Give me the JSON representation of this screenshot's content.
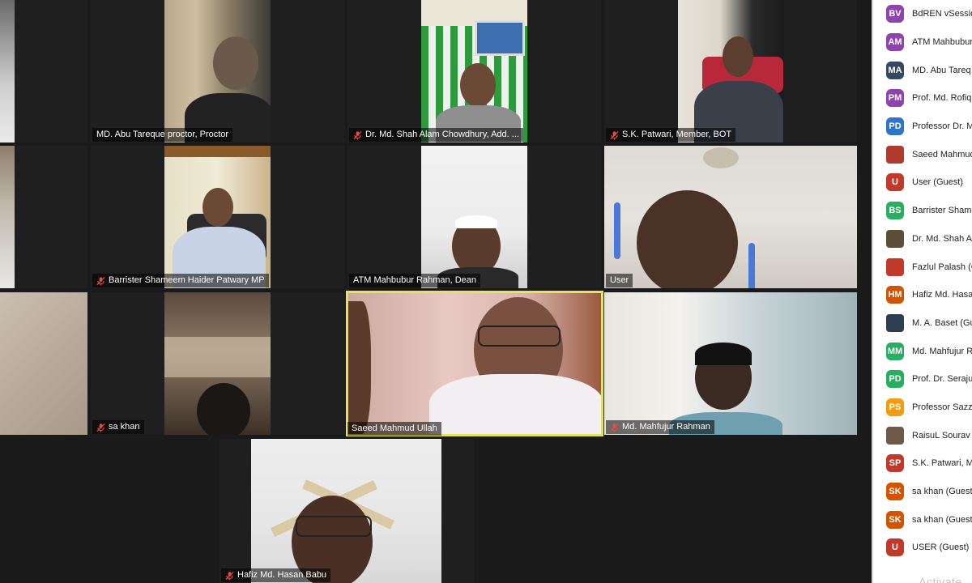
{
  "tiles": [
    {
      "id": "t1",
      "name": "",
      "muted": false
    },
    {
      "id": "t2",
      "name": "MD. Abu Tareque proctor, Proctor",
      "muted": false
    },
    {
      "id": "t3",
      "name": "Dr. Md. Shah Alam Chowdhury, Add. ...",
      "muted": true
    },
    {
      "id": "t4",
      "name": "S.K. Patwari, Member, BOT",
      "muted": true
    },
    {
      "id": "t5",
      "name": "",
      "muted": false
    },
    {
      "id": "t6",
      "name": "Barrister Shameem Haider Patwary MP",
      "muted": true
    },
    {
      "id": "t7",
      "name": "ATM Mahbubur Rahman, Dean",
      "muted": false
    },
    {
      "id": "t8",
      "name": "User",
      "muted": false
    },
    {
      "id": "t9",
      "name": "",
      "muted": false
    },
    {
      "id": "t10",
      "name": "sa khan",
      "muted": true
    },
    {
      "id": "t11",
      "name": "Saeed Mahmud Ullah",
      "muted": false
    },
    {
      "id": "t12",
      "name": "Md. Mahfujur Rahman",
      "muted": true
    },
    {
      "id": "t13",
      "name": "Hafiz Md. Hasan Babu",
      "muted": true
    }
  ],
  "active_speaker": "Saeed Mahmud Ullah",
  "participants": [
    {
      "initials": "BV",
      "name": "BdREN vSessio",
      "color": "#8e44ad",
      "photo": false
    },
    {
      "initials": "AM",
      "name": "ATM Mahbubur",
      "color": "#8e44ad",
      "photo": false
    },
    {
      "initials": "MA",
      "name": "MD. Abu Tareq",
      "color": "#34495e",
      "photo": false
    },
    {
      "initials": "PM",
      "name": "Prof. Md. Rofiq",
      "color": "#8e44ad",
      "photo": false
    },
    {
      "initials": "PD",
      "name": "Professor Dr. M",
      "color": "#2e74c9",
      "photo": false
    },
    {
      "initials": "",
      "name": "Saeed Mahmud",
      "color": "#b03a2e",
      "photo": true
    },
    {
      "initials": "U",
      "name": "User (Guest)",
      "color": "#c0392b",
      "photo": false
    },
    {
      "initials": "BS",
      "name": "Barrister Shame",
      "color": "#27ae60",
      "photo": false
    },
    {
      "initials": "",
      "name": "Dr. Md. Shah A",
      "color": "#5d4e3a",
      "photo": true
    },
    {
      "initials": "",
      "name": "Fazlul Palash (G",
      "color": "#c0392b",
      "photo": true
    },
    {
      "initials": "HM",
      "name": "Hafiz Md. Hasa",
      "color": "#d35400",
      "photo": false
    },
    {
      "initials": "",
      "name": "M. A. Baset (Gu",
      "color": "#2c3e50",
      "photo": true
    },
    {
      "initials": "MM",
      "name": "Md. Mahfujur R",
      "color": "#27ae60",
      "photo": false
    },
    {
      "initials": "PD",
      "name": "Prof. Dr. Seraju",
      "color": "#27ae60",
      "photo": false
    },
    {
      "initials": "PS",
      "name": "Professor Sazz",
      "color": "#f39c12",
      "photo": false
    },
    {
      "initials": "",
      "name": "RaisuL Sourav (",
      "color": "#6d5a48",
      "photo": true
    },
    {
      "initials": "SP",
      "name": "S.K. Patwari, M",
      "color": "#c0392b",
      "photo": false
    },
    {
      "initials": "SK",
      "name": "sa khan (Guest)",
      "color": "#d35400",
      "photo": false
    },
    {
      "initials": "SK",
      "name": "sa khan (Guest)",
      "color": "#d35400",
      "photo": false
    },
    {
      "initials": "U",
      "name": "USER (Guest)",
      "color": "#c0392b",
      "photo": false
    }
  ],
  "watermark": "Activate"
}
